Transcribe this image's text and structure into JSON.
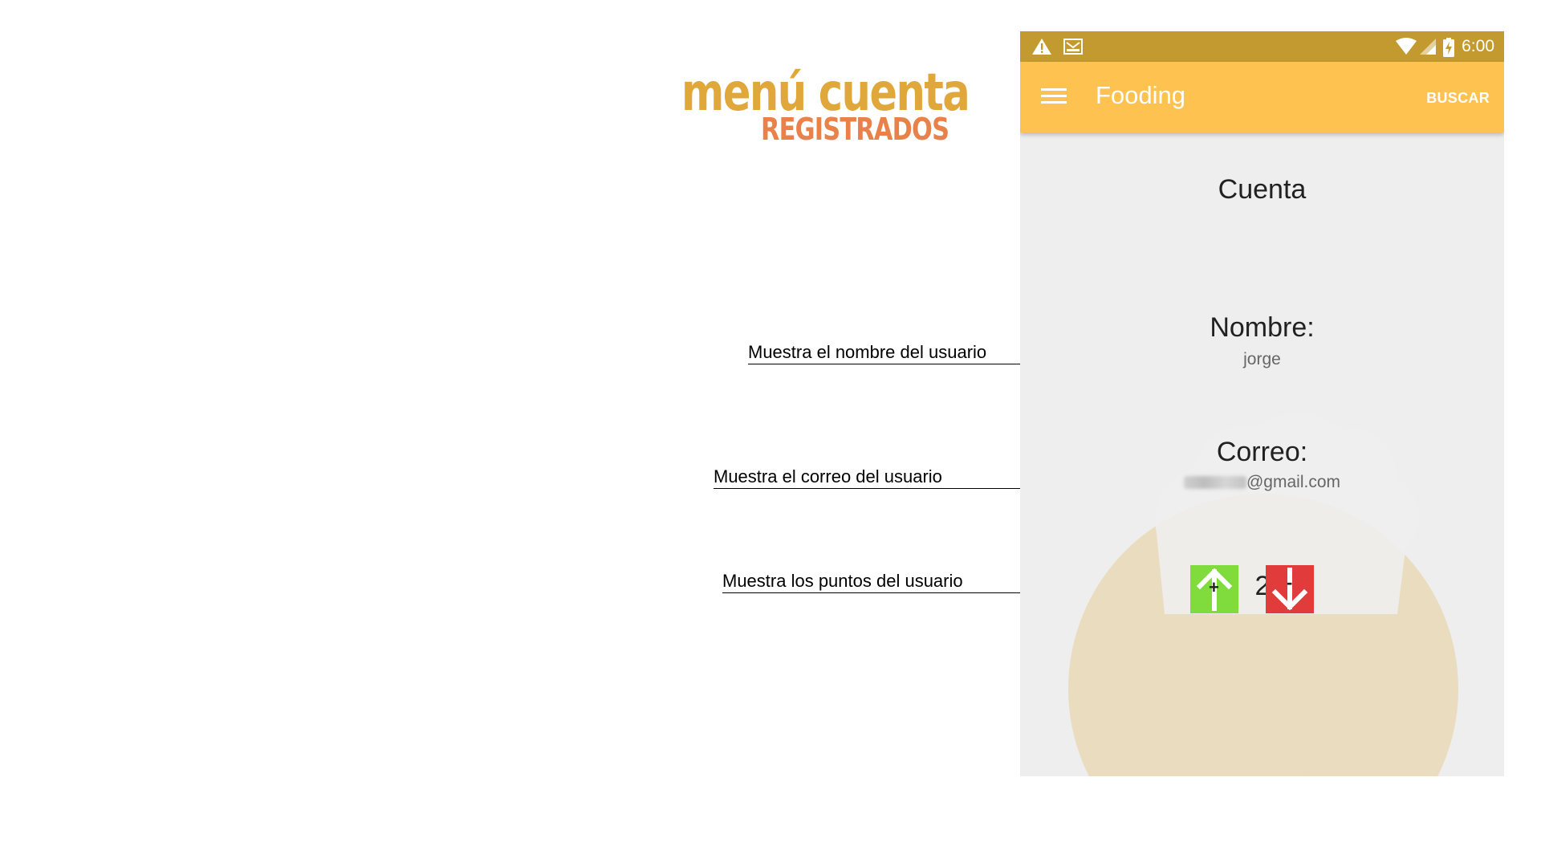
{
  "heading": {
    "line1": "menú cuenta",
    "line2": "registrados"
  },
  "annotations": [
    "Muestra el nombre del usuario",
    "Muestra el correo del usuario",
    "Muestra los puntos del usuario"
  ],
  "status_bar": {
    "time": "6:00",
    "icons": [
      "warning-icon",
      "mail-icon",
      "wifi-icon",
      "signal-icon",
      "battery-charging-icon"
    ]
  },
  "app_bar": {
    "menu_icon": "hamburger-menu-icon",
    "title": "Fooding",
    "action": "BUSCAR"
  },
  "account": {
    "title": "Cuenta",
    "name_label": "Nombre:",
    "name_value": "jorge",
    "email_label": "Correo:",
    "email_domain": "@gmail.com",
    "points": "2",
    "upvote_icon": "arrow-up-icon",
    "upvote_symbol": "+",
    "downvote_icon": "arrow-down-icon",
    "downvote_symbol": "-"
  },
  "colors": {
    "status_bar": "#c29a2f",
    "app_bar": "#fdc24f",
    "upvote": "#7fdc3c",
    "downvote": "#e23b3b",
    "title_orange": "#e0a73a",
    "subtitle_orange": "#e8824a"
  }
}
